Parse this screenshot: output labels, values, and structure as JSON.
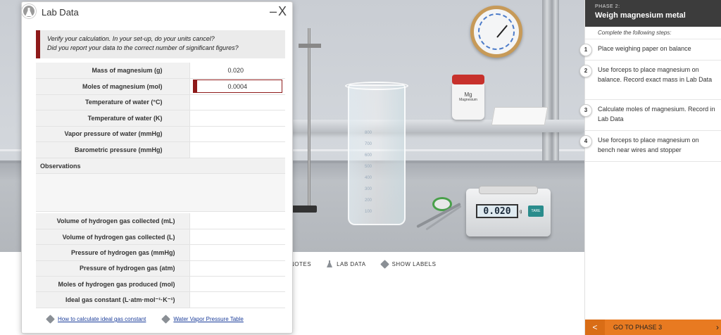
{
  "lab_window": {
    "title": "Lab Data",
    "minimize": "–",
    "close": "X",
    "alert_line1": "Verify your calculation. In your set-up, do your units cancel?",
    "alert_line2": "Did you report your data to the correct number of significant figures?",
    "rows": [
      {
        "label": "Mass of magnesium (g)",
        "value": "0.020"
      },
      {
        "label": "Moles of magnesium (mol)",
        "value": "0.0004"
      },
      {
        "label": "Temperature of water (°C)",
        "value": ""
      },
      {
        "label": "Temperature of water (K)",
        "value": ""
      },
      {
        "label": "Vapor pressure of water (mmHg)",
        "value": ""
      },
      {
        "label": "Barometric pressure (mmHg)",
        "value": ""
      }
    ],
    "observations_label": "Observations",
    "gas_rows": [
      {
        "label": "Volume of hydrogen gas collected (mL)",
        "value": ""
      },
      {
        "label": "Volume of hydrogen gas collected (L)",
        "value": ""
      },
      {
        "label": "Pressure of hydrogen gas (mmHg)",
        "value": ""
      },
      {
        "label": "Pressure of hydrogen gas (atm)",
        "value": ""
      },
      {
        "label": "Moles of hydrogen gas produced (mol)",
        "value": ""
      },
      {
        "label": "Ideal gas constant (L·atm·mol⁻¹·K⁻¹)",
        "value": ""
      }
    ],
    "links": {
      "ideal_gas": "How to calculate ideal gas constant",
      "vapor_table": "Water Vapor Pressure Table"
    }
  },
  "scene": {
    "balance_display": "0.020",
    "balance_unit": "g",
    "tare_label": "TARE",
    "jar_label": "Mg",
    "jar_sublabel": "Magnesium",
    "beaker_marks": [
      "800",
      "700",
      "600",
      "500",
      "400",
      "300",
      "200",
      "100"
    ]
  },
  "toolbar": {
    "notes": "NOTES",
    "lab_data": "LAB DATA",
    "show_labels": "SHOW LABELS"
  },
  "steps_panel": {
    "phase_number": "PHASE 2:",
    "phase_title": "Weigh magnesium metal",
    "instruction": "Complete the following steps:",
    "steps": [
      {
        "num": "1",
        "text": "Place weighing paper on balance"
      },
      {
        "num": "2",
        "text": "Use forceps to place magnesium on balance. Record exact mass in Lab Data"
      },
      {
        "num": "3",
        "text": "Calculate moles of magnesium. Record in Lab Data"
      },
      {
        "num": "4",
        "text": "Use forceps to place magnesium on bench near wires and stopper"
      }
    ],
    "back": "<",
    "next": "GO TO PHASE 3"
  },
  "colors": {
    "accent_red": "#8e1a1a",
    "orange": "#e87a21",
    "header_dark": "#3c3c3c",
    "link_blue": "#1a3c9a"
  },
  "icons": [
    "flask-icon",
    "tag-icon",
    "close-icon",
    "minimize-icon",
    "chevron-left-icon",
    "chevron-right-icon"
  ]
}
